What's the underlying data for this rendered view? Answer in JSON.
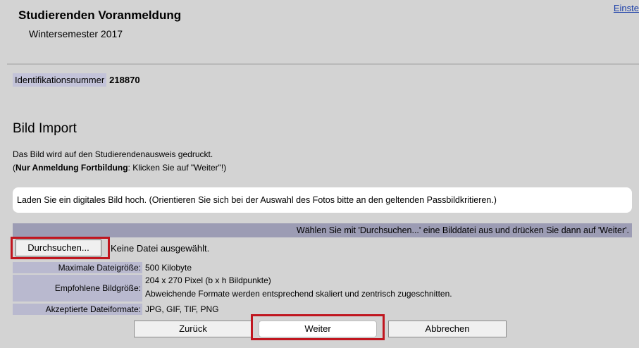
{
  "header": {
    "title": "Studierenden Voranmeldung",
    "subtitle": "Wintersemester 2017",
    "settings_link": "Einste"
  },
  "identification": {
    "label": "Identifikationsnummer",
    "value": "218870"
  },
  "section": {
    "title": "Bild Import",
    "description": "Das Bild wird auf den Studierendenausweis gedruckt.",
    "note_prefix": "(",
    "note_bold": "Nur Anmeldung Fortbildung",
    "note_rest": ": Klicken Sie auf \"Weiter\"!)"
  },
  "upload": {
    "prompt": "Laden Sie ein digitales Bild hoch. (Orientieren Sie sich bei der Auswahl des Fotos bitte an den geltenden Passbildkritieren.)",
    "instruction": "Wählen Sie mit 'Durchsuchen...' eine Bilddatei aus und drücken Sie dann auf 'Weiter'.",
    "browse_label": "Durchsuchen...",
    "no_file": "Keine Datei ausgewählt."
  },
  "info": {
    "max_size_label": "Maximale Dateigröße:",
    "max_size_value": "500 Kilobyte",
    "recommended_label": "Empfohlene Bildgröße:",
    "recommended_value_1": "204 x 270 Pixel (b x h Bildpunkte)",
    "recommended_value_2": "Abweichende Formate werden entsprechend skaliert und zentrisch zugeschnitten.",
    "formats_label": "Akzeptierte Dateiformate:",
    "formats_value": "JPG, GIF, TIF, PNG"
  },
  "buttons": {
    "back": "Zurück",
    "next": "Weiter",
    "cancel": "Abbrechen"
  },
  "colors": {
    "page_bg": "#d3d3d3",
    "label_bg": "#b9b9cf",
    "instruction_bg": "#9c9cb4",
    "highlight": "#c0161f"
  }
}
